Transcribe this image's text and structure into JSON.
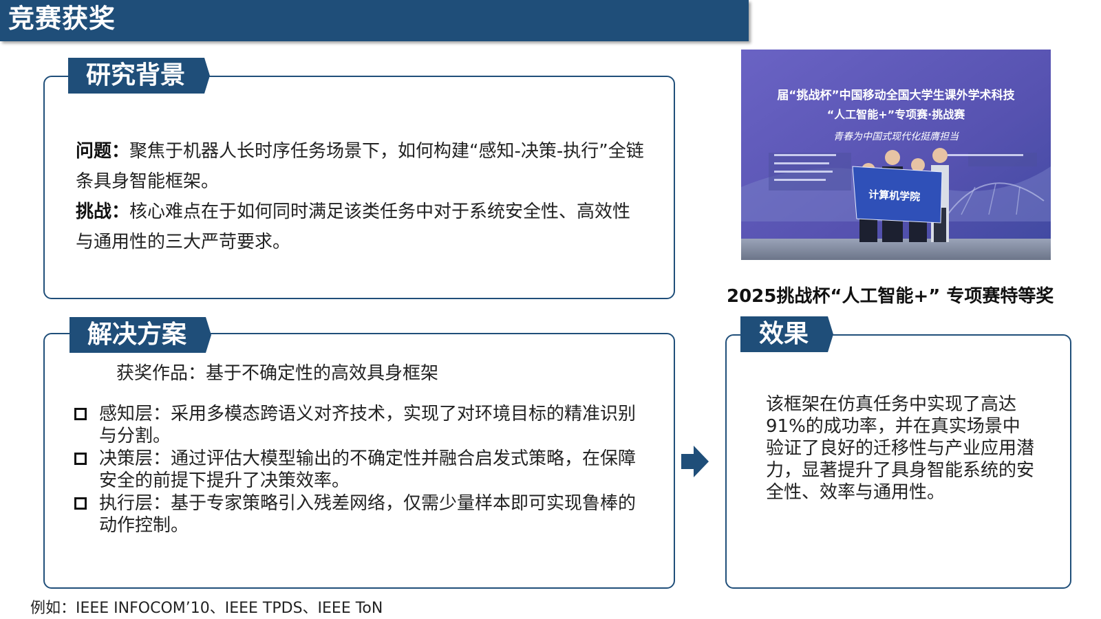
{
  "header": {
    "title": "竞赛获奖"
  },
  "background": {
    "tab": "研究背景",
    "problem_label": "问题：",
    "problem_text": "聚焦于机器人长时序任务场景下，如何构建“感知-决策-执行”全链条具身智能框架。",
    "challenge_label": "挑战：",
    "challenge_text": "核心难点在于如何同时满足该类任务中对于系统安全性、高效性与通用性的三大严苛要求。"
  },
  "solution": {
    "tab": "解决方案",
    "work": "获奖作品：基于不确定性的高效具身框架",
    "items": [
      "感知层：采用多模态跨语义对齐技术，实现了对环境目标的精准识别与分割。",
      "决策层：通过评估大模型输出的不确定性并融合启发式策略，在保障安全的前提下提升了决策效率。",
      "执行层：基于专家策略引入残差网络，仅需少量样本即可实现鲁棒的动作控制。"
    ]
  },
  "photo": {
    "banner_line1": "届“挑战杯”中国移动全国大学生课外学术科技",
    "banner_line2": "“人工智能+”专项赛·挑战赛",
    "banner_line3": "青春为中国式现代化挺膺担当",
    "flag_text": "计算机学院"
  },
  "award": {
    "caption": "2025挑战杯“人工智能+” 专项赛特等奖"
  },
  "effect": {
    "tab": "效果",
    "text": "该框架在仿真任务中实现了高达91%的成功率，并在真实场景中验证了良好的迁移性与产业应用潜力，显著提升了具身智能系统的安全性、效率与通用性。"
  },
  "footer": {
    "text": "例如：IEEE INFOCOM’10、IEEE TPDS、IEEE ToN"
  },
  "colors": {
    "primary": "#1f4e79",
    "text": "#222222",
    "photo_bg": "#5b5ab8"
  }
}
